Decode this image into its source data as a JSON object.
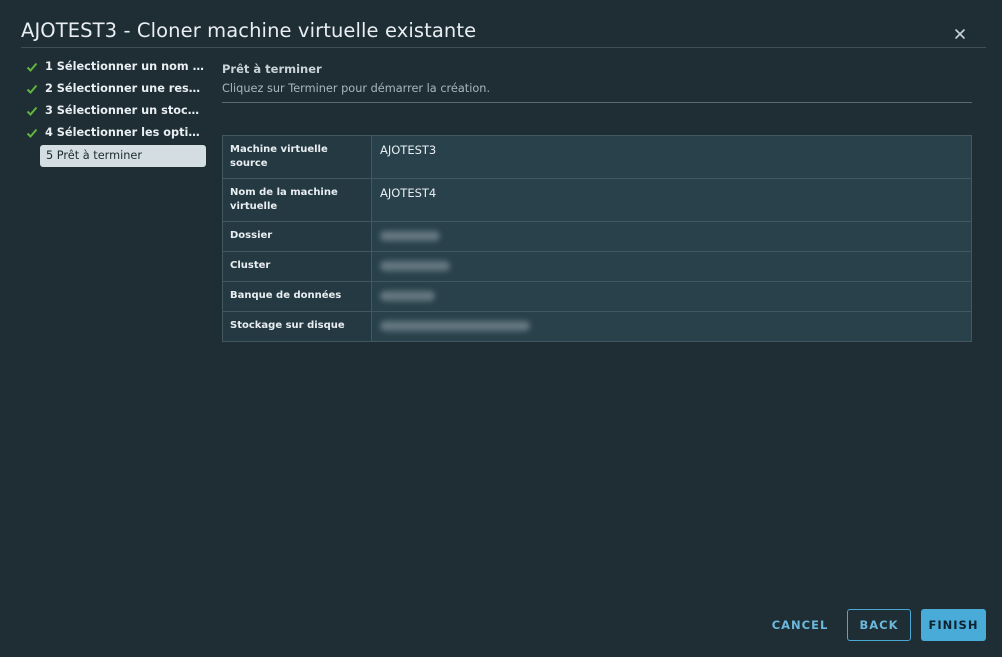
{
  "dialog": {
    "title": "AJOTEST3 - Cloner machine virtuelle existante",
    "close_icon": "close-icon"
  },
  "steps": [
    {
      "label": "1 Sélectionner un nom et u...",
      "status": "done"
    },
    {
      "label": "2 Sélectionner une ressour...",
      "status": "done"
    },
    {
      "label": "3 Sélectionner un stockage",
      "status": "done"
    },
    {
      "label": "4 Sélectionner les options ...",
      "status": "done"
    },
    {
      "label": "5 Prêt à terminer",
      "status": "active"
    }
  ],
  "content": {
    "title": "Prêt à terminer",
    "description": "Cliquez sur Terminer pour démarrer la création."
  },
  "summary": [
    {
      "key": "Machine virtuelle source",
      "value": "AJOTEST3"
    },
    {
      "key": "Nom de la machine virtuelle",
      "value": "AJOTEST4"
    },
    {
      "key": "Dossier",
      "value": ""
    },
    {
      "key": "Cluster",
      "value": ""
    },
    {
      "key": "Banque de données",
      "value": ""
    },
    {
      "key": "Stockage sur disque",
      "value": ""
    }
  ],
  "buttons": {
    "cancel": "CANCEL",
    "back": "BACK",
    "finish": "FINISH"
  },
  "colors": {
    "background": "#1f2d35",
    "check": "#5fb53d",
    "accent": "#49acd8"
  }
}
